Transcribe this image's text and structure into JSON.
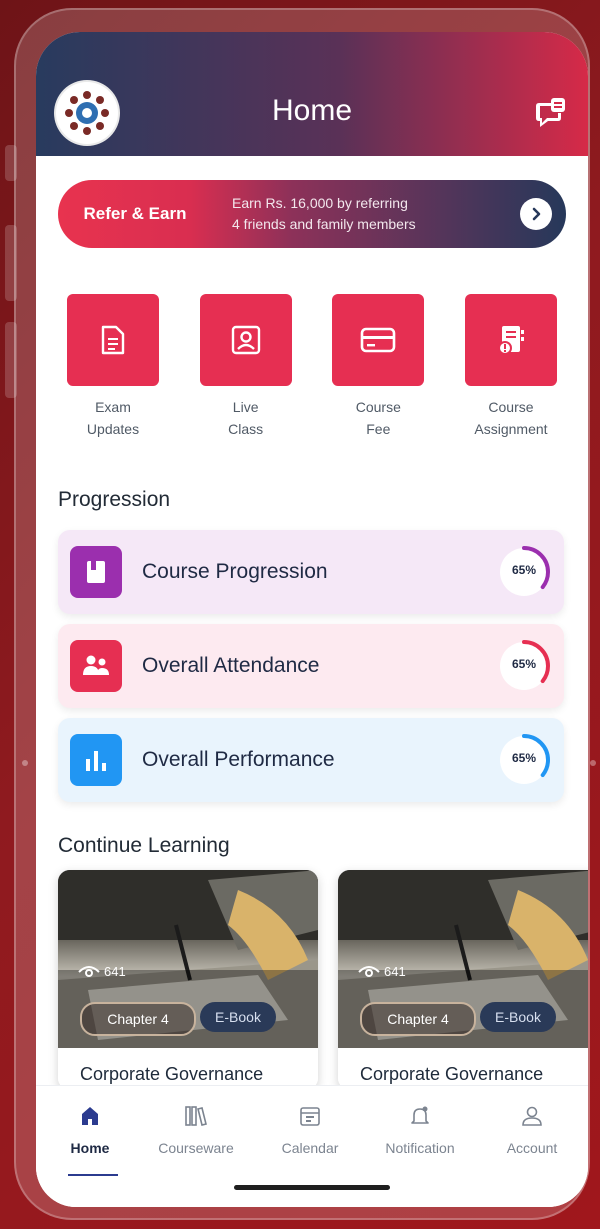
{
  "header": {
    "title": "Home"
  },
  "refer": {
    "label": "Refer & Earn",
    "line1": "Earn Rs. 16,000 by referring",
    "line2": "4 friends and family members"
  },
  "quick_actions": [
    {
      "label": "Exam\nUpdates",
      "icon": "document-icon"
    },
    {
      "label": "Live\nClass",
      "icon": "portrait-icon"
    },
    {
      "label": "Course\nFee",
      "icon": "card-icon"
    },
    {
      "label": "Course\nAssignment",
      "icon": "notebook-icon"
    }
  ],
  "progression": {
    "title": "Progression",
    "items": [
      {
        "label": "Course Progression",
        "percent": 65,
        "percent_label": "65%",
        "bg": "#f5e8f7",
        "icon_bg": "#9b2fae",
        "ring": "#9b2fae"
      },
      {
        "label": "Overall Attendance",
        "percent": 65,
        "percent_label": "65%",
        "bg": "#fdeaf0",
        "icon_bg": "#e62f52",
        "ring": "#e62f52"
      },
      {
        "label": "Overall Performance",
        "percent": 65,
        "percent_label": "65%",
        "bg": "#e9f4fd",
        "icon_bg": "#2196f3",
        "ring": "#2196f3"
      }
    ]
  },
  "continue": {
    "title": "Continue Learning",
    "cards": [
      {
        "views": "641",
        "chapter": "Chapter 4",
        "type": "E-Book",
        "title": "Corporate Governance"
      },
      {
        "views": "641",
        "chapter": "Chapter 4",
        "type": "E-Book",
        "title": "Corporate Governance"
      }
    ]
  },
  "tabs": [
    {
      "label": "Home",
      "icon": "home-icon",
      "active": true
    },
    {
      "label": "Courseware",
      "icon": "books-icon"
    },
    {
      "label": "Calendar",
      "icon": "calendar-icon"
    },
    {
      "label": "Notification",
      "icon": "bell-icon"
    },
    {
      "label": "Account",
      "icon": "user-icon"
    }
  ]
}
